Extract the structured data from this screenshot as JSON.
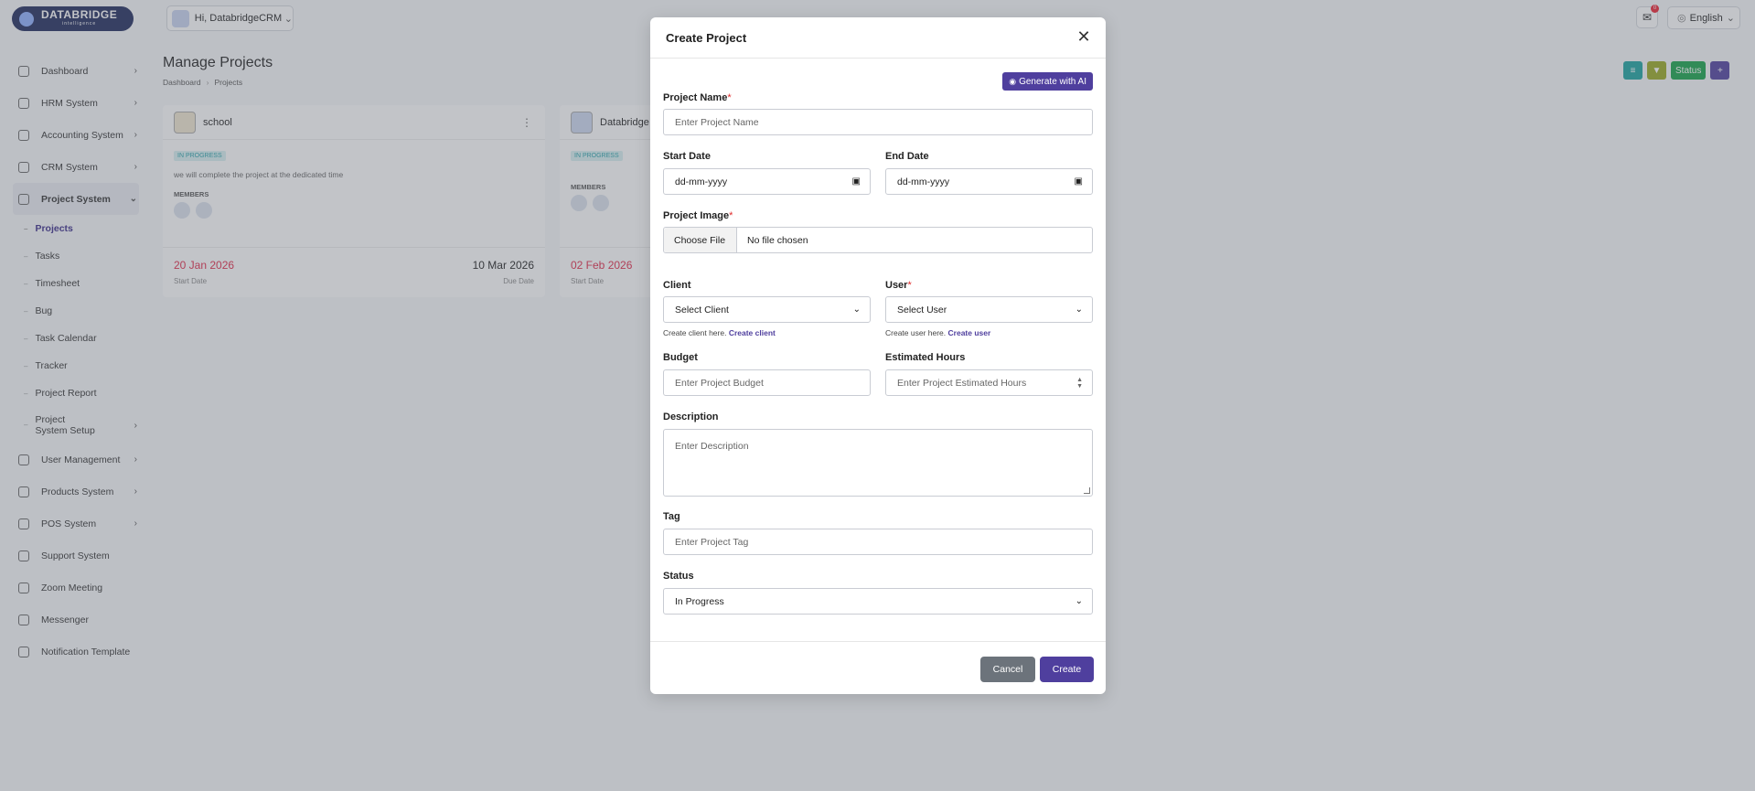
{
  "app": {
    "logo_text": "DATABRIDGE",
    "logo_sub": "intelligence",
    "user_greeting": "Hi, DatabridgeCRM!",
    "notification_count": "0",
    "language": "English"
  },
  "sidebar": {
    "items": [
      {
        "label": "Dashboard",
        "icon": "home-icon",
        "chevron": ">"
      },
      {
        "label": "HRM System",
        "icon": "user-icon",
        "chevron": ">"
      },
      {
        "label": "Accounting System",
        "icon": "box-icon",
        "chevron": ">"
      },
      {
        "label": "CRM System",
        "icon": "layers-icon",
        "chevron": ">"
      },
      {
        "label": "Project System",
        "icon": "share-icon",
        "chevron": "v"
      }
    ],
    "sub_items": [
      "Projects",
      "Tasks",
      "Timesheet",
      "Bug",
      "Task Calendar",
      "Tracker",
      "Project Report",
      "Project System Setup"
    ],
    "items_after": [
      {
        "label": "User Management",
        "icon": "users-icon",
        "chevron": ">"
      },
      {
        "label": "Products System",
        "icon": "cart-icon",
        "chevron": ">"
      },
      {
        "label": "POS System",
        "icon": "layers-icon",
        "chevron": ">"
      },
      {
        "label": "Support System",
        "icon": "headset-icon",
        "chevron": ""
      },
      {
        "label": "Zoom Meeting",
        "icon": "user-plus-icon",
        "chevron": ""
      },
      {
        "label": "Messenger",
        "icon": "chat-icon",
        "chevron": ""
      },
      {
        "label": "Notification Template",
        "icon": "note-icon",
        "chevron": ""
      }
    ]
  },
  "page": {
    "title": "Manage Projects",
    "breadcrumb": [
      "Dashboard",
      "Projects"
    ],
    "status_button": "Status",
    "add_button": "+"
  },
  "cards": [
    {
      "name": "school",
      "status": "IN PROGRESS",
      "description": "we will complete the project at the dedicated time",
      "members_label": "MEMBERS",
      "start_date": "20 Jan 2026",
      "due_date": "10 Mar 2026",
      "start_label": "Start Date",
      "due_label": "Due Date"
    },
    {
      "name": "Databridge",
      "status": "IN PROGRESS",
      "description": "",
      "members_label": "MEMBERS",
      "start_date": "02 Feb 2026",
      "due_date": "",
      "start_label": "Start Date",
      "due_label": ""
    }
  ],
  "modal": {
    "title": "Create Project",
    "generate_ai": "Generate with AI",
    "project_name_label": "Project Name",
    "project_name_placeholder": "Enter Project Name",
    "start_date_label": "Start Date",
    "start_date_value": "dd-mm-yyyy",
    "end_date_label": "End Date",
    "end_date_value": "dd-mm-yyyy",
    "project_image_label": "Project Image",
    "choose_file": "Choose File",
    "no_file": "No file chosen",
    "client_label": "Client",
    "client_value": "Select Client",
    "client_help": "Create client here.",
    "client_link": "Create client",
    "user_label": "User",
    "user_value": "Select User",
    "user_help": "Create user here.",
    "user_link": "Create user",
    "budget_label": "Budget",
    "budget_placeholder": "Enter Project Budget",
    "hours_label": "Estimated Hours",
    "hours_placeholder": "Enter Project Estimated Hours",
    "description_label": "Description",
    "description_placeholder": "Enter Description",
    "tag_label": "Tag",
    "tag_placeholder": "Enter Project Tag",
    "status_label": "Status",
    "status_value": "In Progress",
    "required_mark": "*",
    "cancel": "Cancel",
    "create": "Create"
  },
  "colors": {
    "primary": "#4f3f9e",
    "cancel": "#6c737b",
    "danger": "#e22a4a",
    "badge_bg": "#d8f1f2",
    "btn_teal": "#1aa3a0",
    "btn_olive": "#9aaa23",
    "btn_green": "#16a34a"
  }
}
